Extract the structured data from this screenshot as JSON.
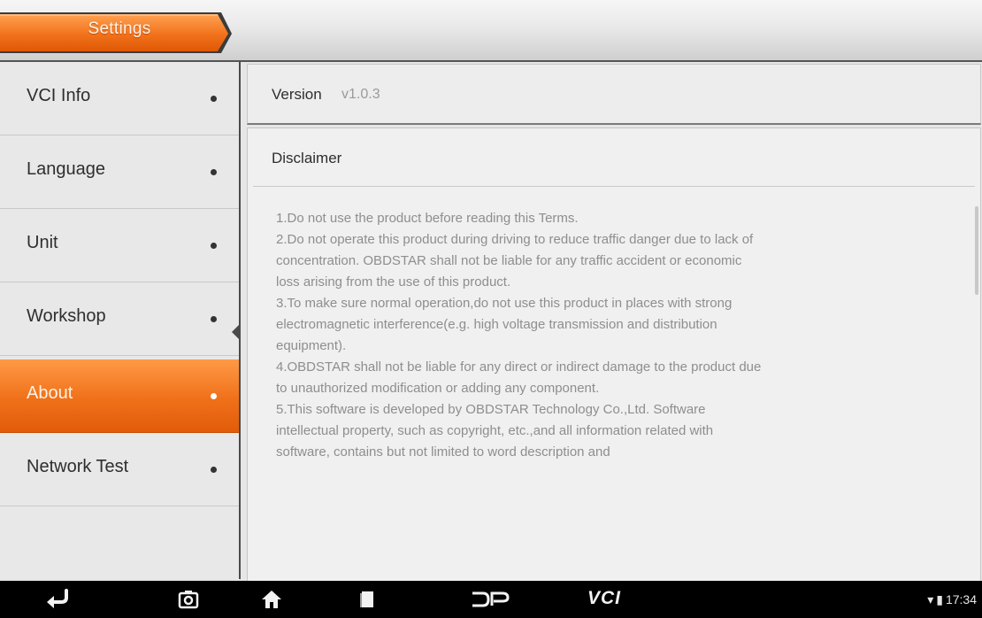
{
  "header": {
    "breadcrumb_label": "Settings"
  },
  "sidebar": {
    "items": [
      {
        "label": "VCI Info",
        "active": false
      },
      {
        "label": "Language",
        "active": false
      },
      {
        "label": "Unit",
        "active": false
      },
      {
        "label": "Workshop",
        "active": false
      },
      {
        "label": "About",
        "active": true
      },
      {
        "label": "Network Test",
        "active": false
      }
    ]
  },
  "main": {
    "version": {
      "label": "Version",
      "value": "v1.0.3"
    },
    "disclaimer": {
      "title": "Disclaimer",
      "lines": [
        "1.Do not use the product before reading this Terms.",
        "2.Do not operate this product during driving to reduce traffic danger due to lack of",
        "concentration. OBDSTAR shall not be liable for any traffic accident or economic",
        "loss arising from the use of this product.",
        "3.To make sure normal operation,do not use this product in places with strong",
        "electromagnetic interference(e.g. high voltage transmission and distribution",
        "equipment).",
        "4.OBDSTAR shall not be liable for any direct or indirect damage to the product due",
        "to unauthorized modification or adding any component.",
        "5.This software is developed by OBDSTAR Technology Co.,Ltd. Software",
        "intellectual property, such as copyright, etc.,and all information related with",
        "software, contains but not limited to word description and"
      ]
    }
  },
  "navbar": {
    "icons": [
      "back-icon",
      "screenshot-icon",
      "home-icon",
      "recent-apps-icon",
      "dp-icon",
      "vci-icon"
    ],
    "vci_label": "VCI",
    "time": "17:34"
  },
  "colors": {
    "accent": "#f0701a",
    "accent_dark": "#e25c08",
    "navbar": "#000000"
  }
}
